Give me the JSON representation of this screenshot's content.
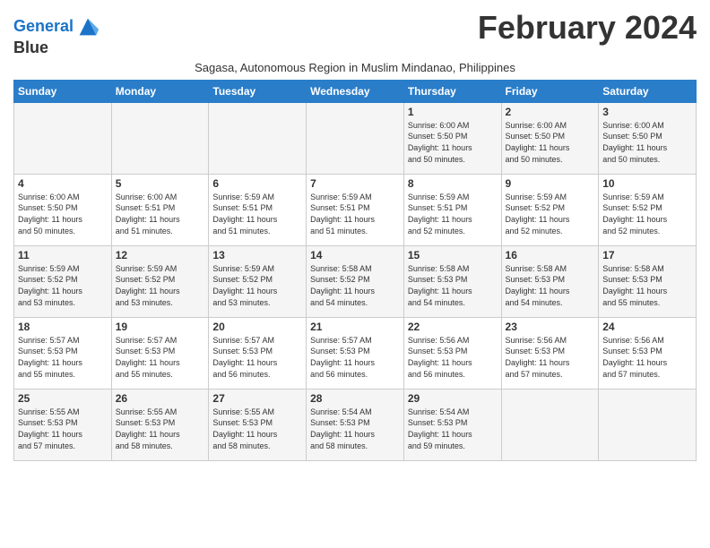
{
  "logo": {
    "line1": "General",
    "line2": "Blue"
  },
  "title": "February 2024",
  "subtitle": "Sagasa, Autonomous Region in Muslim Mindanao, Philippines",
  "days_of_week": [
    "Sunday",
    "Monday",
    "Tuesday",
    "Wednesday",
    "Thursday",
    "Friday",
    "Saturday"
  ],
  "weeks": [
    [
      {
        "day": "",
        "text": ""
      },
      {
        "day": "",
        "text": ""
      },
      {
        "day": "",
        "text": ""
      },
      {
        "day": "",
        "text": ""
      },
      {
        "day": "1",
        "text": "Sunrise: 6:00 AM\nSunset: 5:50 PM\nDaylight: 11 hours\nand 50 minutes."
      },
      {
        "day": "2",
        "text": "Sunrise: 6:00 AM\nSunset: 5:50 PM\nDaylight: 11 hours\nand 50 minutes."
      },
      {
        "day": "3",
        "text": "Sunrise: 6:00 AM\nSunset: 5:50 PM\nDaylight: 11 hours\nand 50 minutes."
      }
    ],
    [
      {
        "day": "4",
        "text": "Sunrise: 6:00 AM\nSunset: 5:50 PM\nDaylight: 11 hours\nand 50 minutes."
      },
      {
        "day": "5",
        "text": "Sunrise: 6:00 AM\nSunset: 5:51 PM\nDaylight: 11 hours\nand 51 minutes."
      },
      {
        "day": "6",
        "text": "Sunrise: 5:59 AM\nSunset: 5:51 PM\nDaylight: 11 hours\nand 51 minutes."
      },
      {
        "day": "7",
        "text": "Sunrise: 5:59 AM\nSunset: 5:51 PM\nDaylight: 11 hours\nand 51 minutes."
      },
      {
        "day": "8",
        "text": "Sunrise: 5:59 AM\nSunset: 5:51 PM\nDaylight: 11 hours\nand 52 minutes."
      },
      {
        "day": "9",
        "text": "Sunrise: 5:59 AM\nSunset: 5:52 PM\nDaylight: 11 hours\nand 52 minutes."
      },
      {
        "day": "10",
        "text": "Sunrise: 5:59 AM\nSunset: 5:52 PM\nDaylight: 11 hours\nand 52 minutes."
      }
    ],
    [
      {
        "day": "11",
        "text": "Sunrise: 5:59 AM\nSunset: 5:52 PM\nDaylight: 11 hours\nand 53 minutes."
      },
      {
        "day": "12",
        "text": "Sunrise: 5:59 AM\nSunset: 5:52 PM\nDaylight: 11 hours\nand 53 minutes."
      },
      {
        "day": "13",
        "text": "Sunrise: 5:59 AM\nSunset: 5:52 PM\nDaylight: 11 hours\nand 53 minutes."
      },
      {
        "day": "14",
        "text": "Sunrise: 5:58 AM\nSunset: 5:52 PM\nDaylight: 11 hours\nand 54 minutes."
      },
      {
        "day": "15",
        "text": "Sunrise: 5:58 AM\nSunset: 5:53 PM\nDaylight: 11 hours\nand 54 minutes."
      },
      {
        "day": "16",
        "text": "Sunrise: 5:58 AM\nSunset: 5:53 PM\nDaylight: 11 hours\nand 54 minutes."
      },
      {
        "day": "17",
        "text": "Sunrise: 5:58 AM\nSunset: 5:53 PM\nDaylight: 11 hours\nand 55 minutes."
      }
    ],
    [
      {
        "day": "18",
        "text": "Sunrise: 5:57 AM\nSunset: 5:53 PM\nDaylight: 11 hours\nand 55 minutes."
      },
      {
        "day": "19",
        "text": "Sunrise: 5:57 AM\nSunset: 5:53 PM\nDaylight: 11 hours\nand 55 minutes."
      },
      {
        "day": "20",
        "text": "Sunrise: 5:57 AM\nSunset: 5:53 PM\nDaylight: 11 hours\nand 56 minutes."
      },
      {
        "day": "21",
        "text": "Sunrise: 5:57 AM\nSunset: 5:53 PM\nDaylight: 11 hours\nand 56 minutes."
      },
      {
        "day": "22",
        "text": "Sunrise: 5:56 AM\nSunset: 5:53 PM\nDaylight: 11 hours\nand 56 minutes."
      },
      {
        "day": "23",
        "text": "Sunrise: 5:56 AM\nSunset: 5:53 PM\nDaylight: 11 hours\nand 57 minutes."
      },
      {
        "day": "24",
        "text": "Sunrise: 5:56 AM\nSunset: 5:53 PM\nDaylight: 11 hours\nand 57 minutes."
      }
    ],
    [
      {
        "day": "25",
        "text": "Sunrise: 5:55 AM\nSunset: 5:53 PM\nDaylight: 11 hours\nand 57 minutes."
      },
      {
        "day": "26",
        "text": "Sunrise: 5:55 AM\nSunset: 5:53 PM\nDaylight: 11 hours\nand 58 minutes."
      },
      {
        "day": "27",
        "text": "Sunrise: 5:55 AM\nSunset: 5:53 PM\nDaylight: 11 hours\nand 58 minutes."
      },
      {
        "day": "28",
        "text": "Sunrise: 5:54 AM\nSunset: 5:53 PM\nDaylight: 11 hours\nand 58 minutes."
      },
      {
        "day": "29",
        "text": "Sunrise: 5:54 AM\nSunset: 5:53 PM\nDaylight: 11 hours\nand 59 minutes."
      },
      {
        "day": "",
        "text": ""
      },
      {
        "day": "",
        "text": ""
      }
    ]
  ]
}
